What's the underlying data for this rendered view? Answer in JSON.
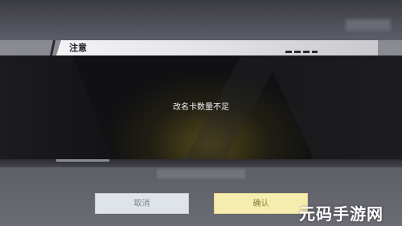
{
  "dialog": {
    "title": "注意",
    "message": "改名卡数量不足"
  },
  "buttons": {
    "cancel_label": "取消",
    "confirm_label": "确认"
  },
  "watermark": "元码手游网",
  "colors": {
    "panel_bg": "#111113",
    "cancel_bg": "#dfe4ea",
    "confirm_bg": "#f5ecaf"
  }
}
